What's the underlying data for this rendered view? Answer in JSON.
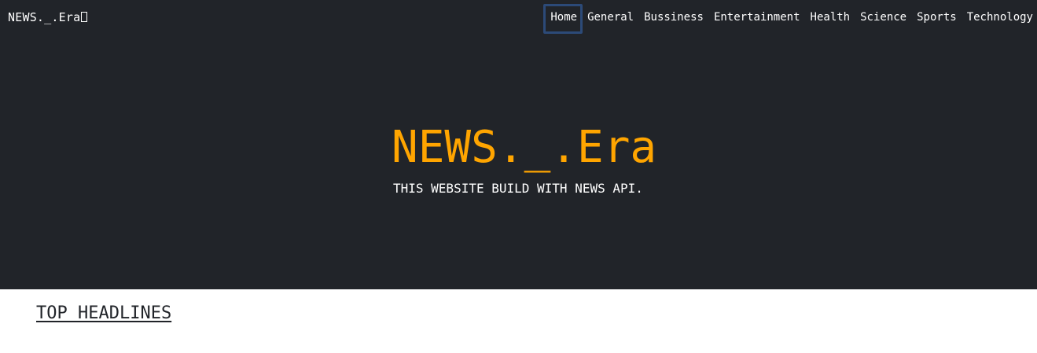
{
  "navbar": {
    "brand": "NEWS._.Era",
    "brand_icon": "missing-glyph-box",
    "links": [
      {
        "label": "Home",
        "active": true
      },
      {
        "label": "General"
      },
      {
        "label": "Bussiness"
      },
      {
        "label": "Entertainment"
      },
      {
        "label": "Health"
      },
      {
        "label": "Science"
      },
      {
        "label": "Sports"
      },
      {
        "label": "Technology"
      }
    ]
  },
  "hero": {
    "title": "NEWS._.Era",
    "subtitle": "THIS WEBSITE BUILD WITH NEWS API."
  },
  "main": {
    "section_heading": "TOP HEADLINES"
  },
  "colors": {
    "dark_background": "#212429",
    "accent": "#ffa500",
    "active_outline": "#2c4a78"
  }
}
